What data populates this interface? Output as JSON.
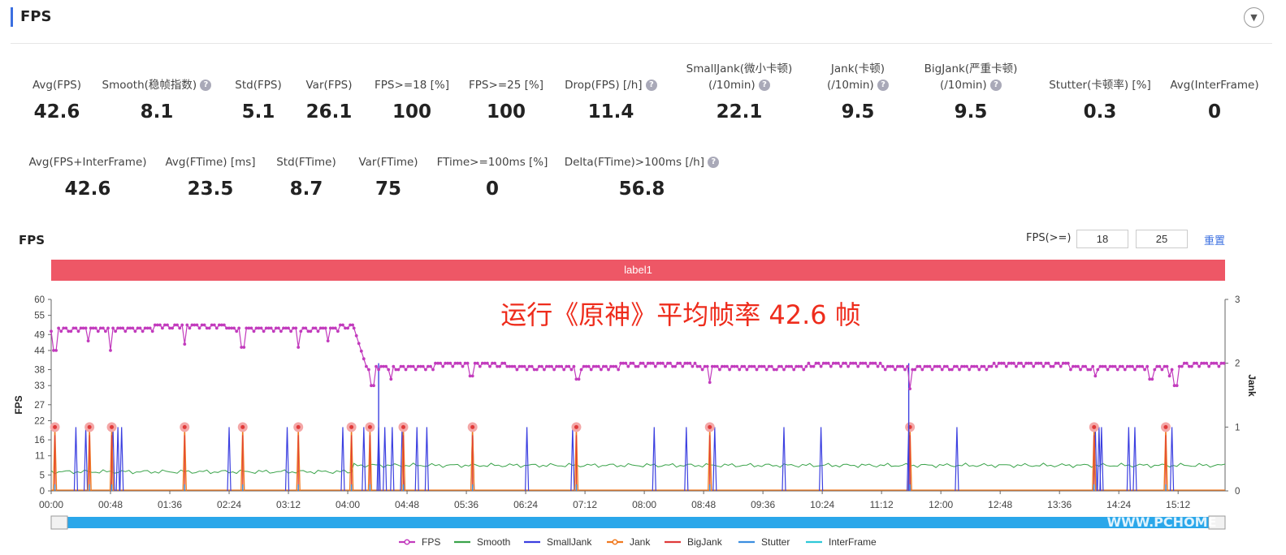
{
  "header": {
    "title": "FPS",
    "collapse_icon": "chevron-down-icon"
  },
  "stats_row1": [
    {
      "label": "Avg(FPS)",
      "value": "42.6"
    },
    {
      "label": "Smooth(稳帧指数)",
      "value": "8.1",
      "help": true
    },
    {
      "label": "Std(FPS)",
      "value": "5.1"
    },
    {
      "label": "Var(FPS)",
      "value": "26.1"
    },
    {
      "label": "FPS>=18 [%]",
      "value": "100"
    },
    {
      "label": "FPS>=25 [%]",
      "value": "100"
    },
    {
      "label": "Drop(FPS) [/h]",
      "value": "11.4",
      "help": true
    },
    {
      "label": "SmallJank(微小卡顿)",
      "label2": "(/10min)",
      "value": "22.1",
      "help": true
    },
    {
      "label": "Jank(卡顿)",
      "label2": "(/10min)",
      "value": "9.5",
      "help": true
    },
    {
      "label": "BigJank(严重卡顿)",
      "label2": "(/10min)",
      "value": "9.5",
      "help": true
    },
    {
      "label": "Stutter(卡顿率) [%]",
      "value": "0.3"
    },
    {
      "label": "Avg(InterFrame)",
      "value": "0"
    }
  ],
  "stats_row2": [
    {
      "label": "Avg(FPS+InterFrame)",
      "value": "42.6"
    },
    {
      "label": "Avg(FTime) [ms]",
      "value": "23.5"
    },
    {
      "label": "Std(FTime)",
      "value": "8.7"
    },
    {
      "label": "Var(FTime)",
      "value": "75"
    },
    {
      "label": "FTime>=100ms [%]",
      "value": "0"
    },
    {
      "label": "Delta(FTime)>100ms [/h]",
      "value": "56.8",
      "help": true
    }
  ],
  "help_glyph": "?",
  "chart_header": {
    "title": "FPS",
    "threshold_label": "FPS(>=)",
    "threshold_1": "18",
    "threshold_2": "25",
    "reset_label": "重置"
  },
  "annotation": "运行《原神》平均帧率 42.6 帧",
  "watermark": "WWW.PCHOME",
  "colors": {
    "fps": "#c23bbd",
    "smooth": "#3aa34a",
    "smalljank": "#3b3fe0",
    "jank": "#f07a20",
    "bigjank": "#e03a3a",
    "stutter": "#3b8ee0",
    "interframe": "#2ec8d8",
    "label_band": "#ee5766",
    "accent": "#3b6fe0",
    "annotation": "#ee2c1c",
    "slider": "#2aa7ea"
  },
  "chart_data": {
    "type": "line",
    "label_band": "label1",
    "ylabel_left": "FPS",
    "ylabel_right": "Jank",
    "y_ticks_left": [
      0,
      5,
      11,
      16,
      22,
      27,
      33,
      38,
      44,
      49,
      55,
      60
    ],
    "ylim_left": [
      0,
      60
    ],
    "y_ticks_right": [
      0,
      1,
      2,
      3
    ],
    "ylim_right": [
      0,
      3
    ],
    "x_ticks": [
      "00:00",
      "00:48",
      "01:36",
      "02:24",
      "03:12",
      "04:00",
      "04:48",
      "05:36",
      "06:24",
      "07:12",
      "08:00",
      "08:48",
      "09:36",
      "10:24",
      "11:12",
      "12:00",
      "12:48",
      "13:36",
      "14:24",
      "15:12"
    ],
    "duration_sec": 950,
    "fps_segments": [
      {
        "t_from": 0,
        "t_to": 245,
        "base": 51,
        "dip_times": [
          3,
          30,
          48,
          108,
          155,
          200,
          224
        ],
        "dip_values": [
          44,
          47,
          44,
          46,
          45,
          45,
          47
        ]
      },
      {
        "t_from": 245,
        "t_to": 255,
        "base": 49
      },
      {
        "t_from": 255,
        "t_to": 950,
        "base": 39,
        "dip_times": [
          260,
          275,
          340,
          426,
          533,
          695,
          845,
          890,
          910,
          905
        ],
        "dip_values": [
          33,
          35,
          36,
          35,
          34,
          32,
          36,
          35,
          33,
          36
        ]
      }
    ],
    "smooth_segments": [
      {
        "t_from": 0,
        "t_to": 245,
        "value": 6
      },
      {
        "t_from": 245,
        "t_to": 950,
        "value": 8
      }
    ],
    "smalljank_times": [
      20,
      28,
      50,
      54,
      57,
      144,
      191,
      236,
      253,
      265,
      270,
      276,
      284,
      296,
      304,
      341,
      385,
      422,
      488,
      514,
      537,
      593,
      623,
      694,
      733,
      848,
      845,
      850,
      872,
      877,
      907
    ],
    "bigjank_times": [
      3,
      31,
      49,
      108,
      155,
      200,
      243,
      258,
      285,
      341,
      425,
      533,
      695,
      844,
      902
    ],
    "series": [
      {
        "name": "FPS"
      },
      {
        "name": "Smooth"
      },
      {
        "name": "SmallJank"
      },
      {
        "name": "Jank"
      },
      {
        "name": "BigJank"
      },
      {
        "name": "Stutter"
      },
      {
        "name": "InterFrame"
      }
    ]
  }
}
